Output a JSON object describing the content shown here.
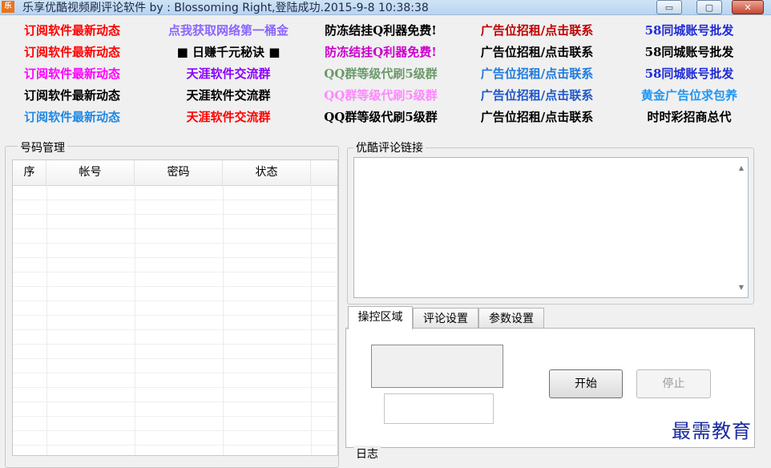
{
  "titlebar": {
    "title": "乐享优酷视频刷评论软件        by : Blossoming        Right,登陆成功.2015-9-8 10:38:38",
    "icon_label": "乐",
    "minimize": "▭",
    "maximize": "▢",
    "close": "✕"
  },
  "ads": {
    "rows": [
      [
        "订阅软件最新动态",
        "点我获取网络第一桶金",
        "防冻结挂Q利器免费!",
        "广告位招租/点击联系",
        "58同城账号批发"
      ],
      [
        "订阅软件最新动态",
        "■ 日赚千元秘诀 ■",
        "防冻结挂Q利器免费!",
        "广告位招租/点击联系",
        "58同城账号批发"
      ],
      [
        "订阅软件最新动态",
        "天涯软件交流群",
        "QQ群等级代刷5级群",
        "广告位招租/点击联系",
        "58同城账号批发"
      ],
      [
        "订阅软件最新动态",
        "天涯软件交流群",
        "QQ群等级代刷5级群",
        "广告位招租/点击联系",
        "黄金广告位求包养"
      ],
      [
        "订阅软件最新动态",
        "天涯软件交流群",
        "QQ群等级代刷5级群",
        "广告位招租/点击联系",
        "时时彩招商总代"
      ]
    ],
    "colors": [
      [
        "#ff0000",
        "#8b66ff",
        "#000000",
        "#c00000",
        "#1f2bd6"
      ],
      [
        "#ff0000",
        "#000000",
        "#cc00cc",
        "#000000",
        "#000000"
      ],
      [
        "#ff00ff",
        "#8a00ff",
        "#6a9a6a",
        "#1e7ae0",
        "#1f2bd6"
      ],
      [
        "#000000",
        "#000000",
        "#ff88ff",
        "#1f57c9",
        "#2196f3"
      ],
      [
        "#1e88e5",
        "#ff0000",
        "#000000",
        "#000000",
        "#000000"
      ]
    ]
  },
  "accounts": {
    "group_label": "号码管理",
    "columns": [
      "序",
      "帐号",
      "密码",
      "状态"
    ]
  },
  "comment_links": {
    "group_label": "优酷评论链接",
    "value": ""
  },
  "tabs": [
    "操控区域",
    "评论设置",
    "参数设置"
  ],
  "controls": {
    "start": "开始",
    "stop": "停止",
    "input_value": ""
  },
  "log": {
    "group_label": "日志"
  },
  "watermark": "最需教育"
}
